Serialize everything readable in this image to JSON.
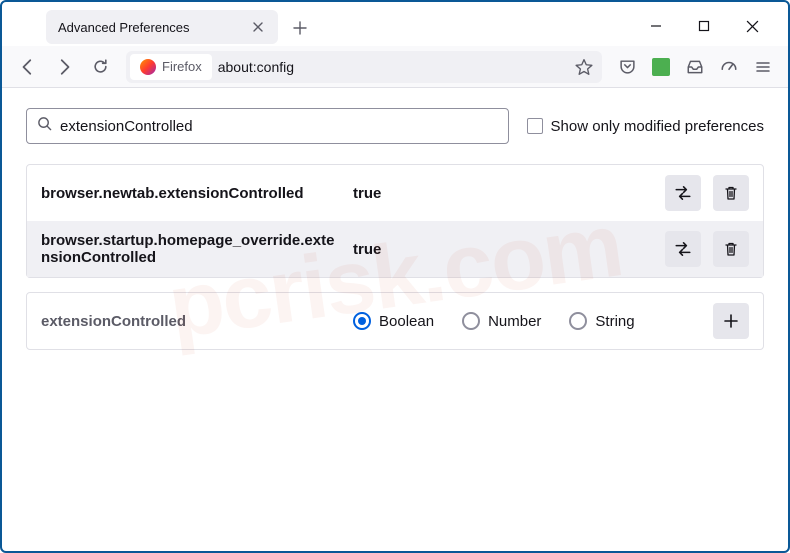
{
  "window": {
    "tab_title": "Advanced Preferences"
  },
  "urlbar": {
    "identity": "Firefox",
    "url": "about:config"
  },
  "config": {
    "search_value": "extensionControlled",
    "show_modified_label": "Show only modified preferences",
    "rows": [
      {
        "name": "browser.newtab.extensionControlled",
        "value": "true"
      },
      {
        "name": "browser.startup.homepage_override.extensionControlled",
        "value": "true"
      }
    ],
    "new_pref": {
      "name": "extensionControlled",
      "types": [
        {
          "label": "Boolean",
          "selected": true
        },
        {
          "label": "Number",
          "selected": false
        },
        {
          "label": "String",
          "selected": false
        }
      ]
    }
  },
  "watermark": "pcrisk.com"
}
